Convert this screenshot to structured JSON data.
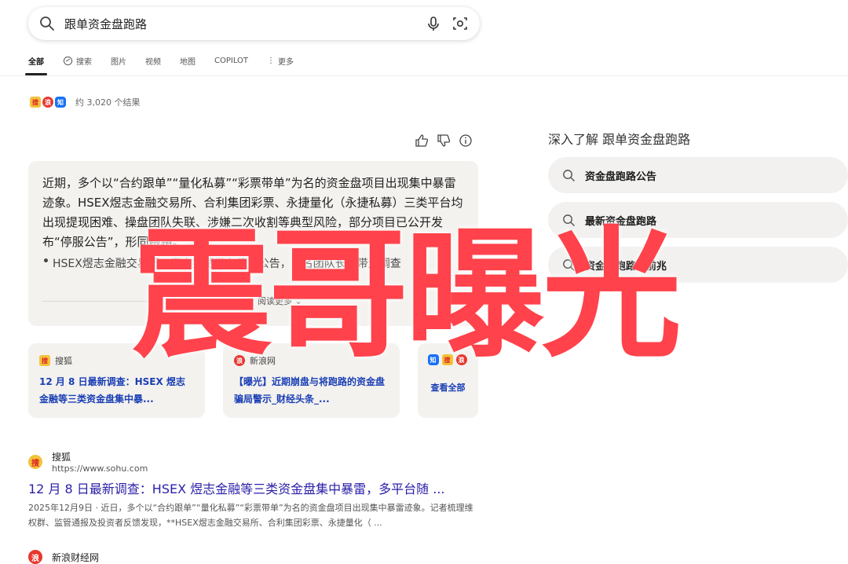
{
  "search": {
    "query": "跟单资金盘跑路"
  },
  "tabs": [
    {
      "label": "全部"
    },
    {
      "label": "搜索"
    },
    {
      "label": "图片"
    },
    {
      "label": "视频"
    },
    {
      "label": "地图"
    },
    {
      "label": "COPILOT"
    },
    {
      "label": "更多"
    }
  ],
  "results_summary": {
    "count_text": "约 3,020 个结果",
    "source_icons": [
      "搜",
      "浪",
      "知"
    ]
  },
  "ai_answer": {
    "paragraph": "近期，多个以“合约跟单”“量化私募”“彩票带单”为名的资金盘项目出现集中暴雷迹象。HSEX煜志金融交易所、合利集团彩票、永捷量化（永捷私募）三类平台均出现提现困难、操盘团队失联、涉嫌二次收割等典型风险，部分项目已公开发布“停服公告”，形同跑路。",
    "cite": "搜狐",
    "bullet": "HSEX煜志金融交易所：官方突然发布停盘公告，多名团队长被带走调查",
    "read_more": "阅读更多"
  },
  "source_cards": [
    {
      "site": "搜狐",
      "title": "12 月 8 日最新调查：HSEX 煜志金融等三类资金盘集中暴..."
    },
    {
      "site": "新浪网",
      "title": "【曝光】近期崩盘与将跑路的资金盘骗局警示_财经头条_..."
    }
  ],
  "see_all": {
    "label": "查看全部"
  },
  "results": [
    {
      "site": "搜狐",
      "url": "https://www.sohu.com",
      "title": "12 月 8 日最新调查：HSEX 煜志金融等三类资金盘集中暴雷，多平台随 ...",
      "snippet": "2025年12月9日 · 近日，多个以“合约跟单”“量化私募”“彩票带单”为名的资金盘项目出现集中暴雷迹象。记者梳理维权群、监管通报及投资者反馈发现，**HSEX煜志金融交易所、合利集团彩票、永捷量化（ ..."
    },
    {
      "site": "新浪财经网"
    }
  ],
  "related": {
    "title": "深入了解 跟单资金盘跑路",
    "items": [
      "资金盘跑路公告",
      "最新资金盘跑路",
      "资金盘跑路的前兆"
    ]
  },
  "watermark": {
    "text": "震哥曝光",
    "color": "#ff2d37"
  }
}
